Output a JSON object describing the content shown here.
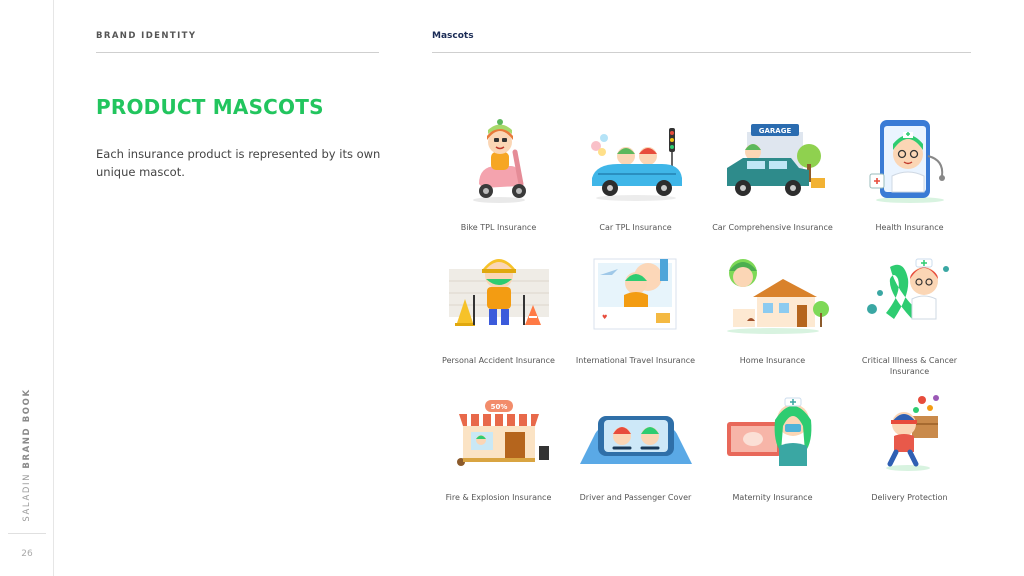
{
  "side": {
    "book_prefix": "SALADIN ",
    "book_strong": "BRAND BOOK",
    "page_number": "26"
  },
  "header": {
    "section": "BRAND IDENTITY",
    "subsection": "Mascots"
  },
  "title": "PRODUCT MASCOTS",
  "description": "Each insurance product is represented by its own unique mascot.",
  "colors": {
    "accent": "#22c55e",
    "navy": "#1a2b55"
  },
  "mascots": [
    {
      "label": "Bike TPL Insurance",
      "icon": "scooter-mascot-icon"
    },
    {
      "label": "Car TPL Insurance",
      "icon": "convertible-car-mascot-icon"
    },
    {
      "label": "Car Comprehensive Insurance",
      "icon": "garage-jeep-mascot-icon",
      "sign": "GARAGE"
    },
    {
      "label": "Health Insurance",
      "icon": "doctor-phone-mascot-icon"
    },
    {
      "label": "Personal Accident Insurance",
      "icon": "construction-worker-mascot-icon"
    },
    {
      "label": "International Travel Insurance",
      "icon": "travel-postcard-mascot-icon"
    },
    {
      "label": "Home Insurance",
      "icon": "house-mascot-icon"
    },
    {
      "label": "Critical Illness & Cancer Insurance",
      "icon": "ribbon-nurse-mascot-icon"
    },
    {
      "label": "Fire & Explosion Insurance",
      "icon": "shopfront-mascot-icon",
      "sign": "50%"
    },
    {
      "label": "Driver and Passenger Cover",
      "icon": "car-interior-mascot-icon"
    },
    {
      "label": "Maternity Insurance",
      "icon": "ultrasound-nurse-mascot-icon"
    },
    {
      "label": "Delivery Protection",
      "icon": "delivery-box-mascot-icon"
    }
  ]
}
